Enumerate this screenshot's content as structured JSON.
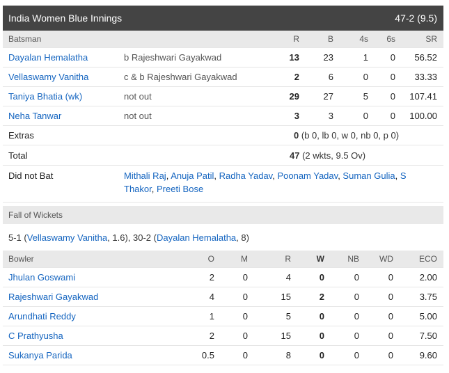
{
  "header": {
    "title": "India Women Blue Innings",
    "score": "47-2 (9.5)"
  },
  "batting": {
    "columns": {
      "batsman": "Batsman",
      "r": "R",
      "b": "B",
      "fours": "4s",
      "sixes": "6s",
      "sr": "SR"
    },
    "rows": [
      {
        "name": "Dayalan Hemalatha",
        "dismissal": "b Rajeshwari Gayakwad",
        "r": "13",
        "b": "23",
        "fours": "1",
        "sixes": "0",
        "sr": "56.52"
      },
      {
        "name": "Vellaswamy Vanitha",
        "dismissal": "c & b Rajeshwari Gayakwad",
        "r": "2",
        "b": "6",
        "fours": "0",
        "sixes": "0",
        "sr": "33.33"
      },
      {
        "name": "Taniya Bhatia (wk)",
        "dismissal": "not out",
        "r": "29",
        "b": "27",
        "fours": "5",
        "sixes": "0",
        "sr": "107.41"
      },
      {
        "name": "Neha Tanwar",
        "dismissal": "not out",
        "r": "3",
        "b": "3",
        "fours": "0",
        "sixes": "0",
        "sr": "100.00"
      }
    ],
    "extras": {
      "label": "Extras",
      "value": "0",
      "detail": "(b 0, lb 0, w 0, nb 0, p 0)"
    },
    "total": {
      "label": "Total",
      "value": "47",
      "detail": "(2 wkts, 9.5 Ov)"
    },
    "did_not_bat": {
      "label": "Did not Bat",
      "players": [
        "Mithali Raj",
        "Anuja Patil",
        "Radha Yadav",
        "Poonam Yadav",
        "Suman Gulia",
        "S Thakor",
        "Preeti Bose"
      ]
    }
  },
  "fall_of_wickets": {
    "title": "Fall of Wickets",
    "wickets": [
      {
        "score": "5-1",
        "player": "Vellaswamy Vanitha",
        "over": "1.6"
      },
      {
        "score": "30-2",
        "player": "Dayalan Hemalatha",
        "over": "8"
      }
    ]
  },
  "bowling": {
    "columns": {
      "bowler": "Bowler",
      "o": "O",
      "m": "M",
      "r": "R",
      "w": "W",
      "nb": "NB",
      "wd": "WD",
      "eco": "ECO"
    },
    "rows": [
      {
        "name": "Jhulan Goswami",
        "o": "2",
        "m": "0",
        "r": "4",
        "w": "0",
        "nb": "0",
        "wd": "0",
        "eco": "2.00"
      },
      {
        "name": "Rajeshwari Gayakwad",
        "o": "4",
        "m": "0",
        "r": "15",
        "w": "2",
        "nb": "0",
        "wd": "0",
        "eco": "3.75"
      },
      {
        "name": "Arundhati Reddy",
        "o": "1",
        "m": "0",
        "r": "5",
        "w": "0",
        "nb": "0",
        "wd": "0",
        "eco": "5.00"
      },
      {
        "name": "C Prathyusha",
        "o": "2",
        "m": "0",
        "r": "15",
        "w": "0",
        "nb": "0",
        "wd": "0",
        "eco": "7.50"
      },
      {
        "name": "Sukanya Parida",
        "o": "0.5",
        "m": "0",
        "r": "8",
        "w": "0",
        "nb": "0",
        "wd": "0",
        "eco": "9.60"
      }
    ]
  }
}
